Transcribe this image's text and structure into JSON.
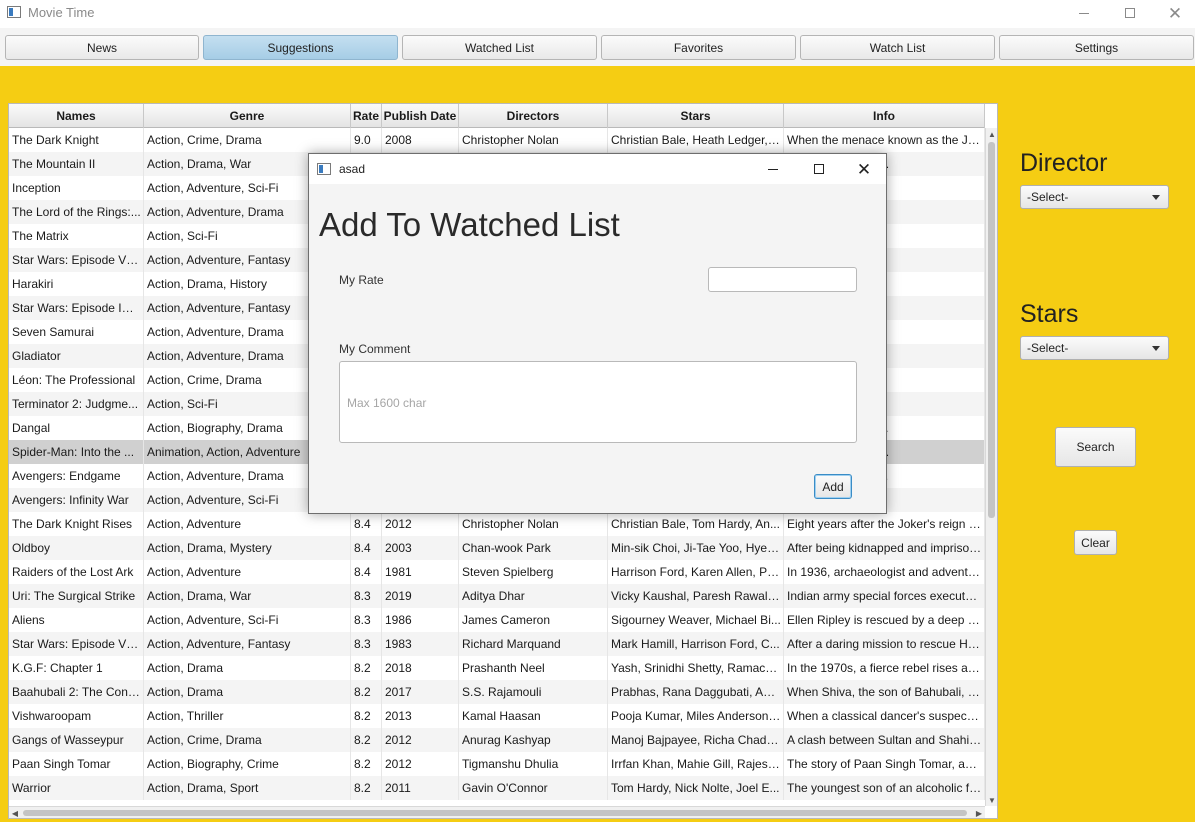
{
  "window": {
    "title": "Movie Time"
  },
  "nav": {
    "tabs": [
      {
        "label": "News"
      },
      {
        "label": "Suggestions",
        "active": true
      },
      {
        "label": "Watched List"
      },
      {
        "label": "Favorites"
      },
      {
        "label": "Watch List"
      },
      {
        "label": "Settings"
      }
    ]
  },
  "colors": {
    "background": "#f5cd13",
    "active_tab": "#a6cde6",
    "selected_row": "#d0d0d0"
  },
  "table": {
    "columns": [
      "Names",
      "Genre",
      "Rate",
      "Publish Date",
      "Directors",
      "Stars",
      "Info"
    ],
    "selected_row": 13,
    "rows": [
      [
        "The Dark Knight",
        "Action, Crime, Drama",
        "9.0",
        "2008",
        "Christopher Nolan",
        "Christian Bale, Heath Ledger, ...",
        "When the menace known as the Joker"
      ],
      [
        "The Mountain II",
        "Action, Drama, War",
        "",
        "",
        "",
        "",
        "one where scream."
      ],
      [
        "Inception",
        "Action, Adventure, Sci-Fi",
        "",
        "",
        "",
        "",
        "orporate secrets t."
      ],
      [
        "The Lord of the Rings:...",
        "Action, Adventure, Drama",
        "",
        "",
        "",
        "",
        "m the Shire and ei."
      ],
      [
        "The Matrix",
        "Action, Sci-Fi",
        "",
        "",
        "",
        "",
        "learns from myst."
      ],
      [
        "Star Wars: Episode V -...",
        "Action, Adventure, Fantasy",
        "",
        "",
        "",
        "",
        "e brutally overpow"
      ],
      [
        "Harakiri",
        "Action, Drama, History",
        "",
        "",
        "",
        "",
        "esting seppuku at"
      ],
      [
        "Star Wars: Episode IV ...",
        "Action, Adventure, Fantasy",
        "",
        "",
        "",
        "",
        "s forces with a Je."
      ],
      [
        "Seven Samurai",
        "Action, Adventure, Drama",
        "",
        "",
        "",
        "",
        "er attack by bandit"
      ],
      [
        "Gladiator",
        "Action, Adventure, Drama",
        "",
        "",
        "",
        "",
        "eneral sets out to ."
      ],
      [
        "Léon: The Professional",
        "Action, Crime, Drama",
        "",
        "",
        "",
        "",
        "r-old girl, is relucta"
      ],
      [
        "Terminator 2: Judgme...",
        "Action, Sci-Fi",
        "",
        "",
        "",
        "",
        "to the one who fai"
      ],
      [
        "Dangal",
        "Action, Biography, Drama",
        "",
        "",
        "",
        "",
        "ahavir Singh Phog."
      ],
      [
        "Spider-Man: Into the ...",
        "Animation, Action, Adventure",
        "",
        "",
        "",
        "",
        "s becomes the Spi."
      ],
      [
        "Avengers: Endgame",
        "Action, Adventure, Drama",
        "",
        "",
        "",
        "",
        "ing events of Aven."
      ],
      [
        "Avengers: Infinity War",
        "Action, Adventure, Sci-Fi",
        "",
        "",
        "",
        "",
        "their allies must b."
      ],
      [
        "The Dark Knight Rises",
        "Action, Adventure",
        "8.4",
        "2012",
        "Christopher Nolan",
        "Christian Bale, Tom Hardy, An...",
        "Eight years after the Joker's reign of ."
      ],
      [
        "Oldboy",
        "Action, Drama, Mystery",
        "8.4",
        "2003",
        "Chan-wook Park",
        "Min-sik Choi, Ji-Tae Yoo, Hye-...",
        "After being kidnapped and imprisoned"
      ],
      [
        "Raiders of the Lost Ark",
        "Action, Adventure",
        "8.4",
        "1981",
        "Steven Spielberg",
        "Harrison Ford, Karen Allen, Pa...",
        "In 1936, archaeologist and adventurer"
      ],
      [
        "Uri: The Surgical Strike",
        "Action, Drama, War",
        "8.3",
        "2019",
        "Aditya Dhar",
        "Vicky Kaushal, Paresh Rawal, ...",
        "Indian army special forces execute a ."
      ],
      [
        "Aliens",
        "Action, Adventure, Sci-Fi",
        "8.3",
        "1986",
        "James Cameron",
        "Sigourney Weaver, Michael Bi...",
        "Ellen Ripley is rescued by a deep salv."
      ],
      [
        "Star Wars: Episode VI ...",
        "Action, Adventure, Fantasy",
        "8.3",
        "1983",
        "Richard Marquand",
        "Mark Hamill, Harrison Ford, C...",
        "After a daring mission to rescue Han ."
      ],
      [
        "K.G.F: Chapter 1",
        "Action, Drama",
        "8.2",
        "2018",
        "Prashanth Neel",
        "Yash, Srinidhi Shetty, Ramach...",
        "In the 1970s, a fierce rebel rises again"
      ],
      [
        "Baahubali 2: The Conc...",
        "Action, Drama",
        "8.2",
        "2017",
        "S.S. Rajamouli",
        "Prabhas, Rana Daggubati, Anu...",
        "When Shiva, the son of Bahubali, lear."
      ],
      [
        "Vishwaroopam",
        "Action, Thriller",
        "8.2",
        "2013",
        "Kamal Haasan",
        "Pooja Kumar, Miles Anderson,...",
        "When a classical dancer's suspecting"
      ],
      [
        "Gangs of Wasseypur",
        "Action, Crime, Drama",
        "8.2",
        "2012",
        "Anurag Kashyap",
        "Manoj Bajpayee, Richa Chadh...",
        "A clash between Sultan and Shahid K."
      ],
      [
        "Paan Singh Tomar",
        "Action, Biography, Crime",
        "8.2",
        "2012",
        "Tigmanshu Dhulia",
        "Irrfan Khan, Mahie Gill, Rajesh...",
        "The story of Paan Singh Tomar, an In."
      ],
      [
        "Warrior",
        "Action, Drama, Sport",
        "8.2",
        "2011",
        "Gavin O'Connor",
        "Tom Hardy, Nick Nolte, Joel E...",
        "The youngest son of an alcoholic for."
      ]
    ]
  },
  "filters": {
    "director_label": "Director",
    "director_value": "-Select-",
    "stars_label": "Stars",
    "stars_value": "-Select-",
    "search_label": "Search",
    "clear_label": "Clear"
  },
  "dialog": {
    "title": "asad",
    "heading": "Add To Watched List",
    "rate_label": "My Rate",
    "rate_value": "",
    "comment_label": "My Comment",
    "comment_placeholder": "Max 1600 char",
    "add_label": "Add"
  }
}
